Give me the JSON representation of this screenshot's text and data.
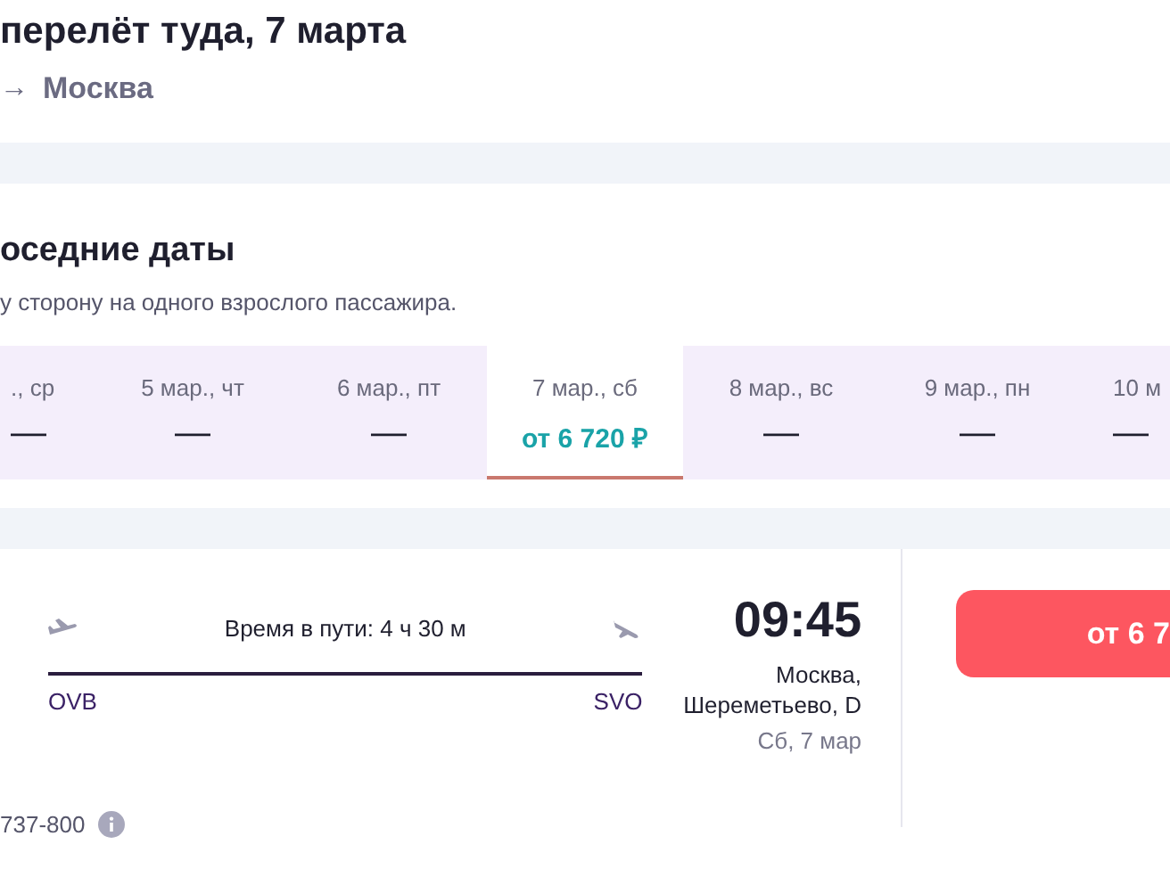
{
  "header": {
    "title": "перелёт туда, 7 марта",
    "route_arrow": "→",
    "route_city": "Москва"
  },
  "nearby_dates": {
    "title": "оседние даты",
    "subtitle": "у сторону на одного взрослого пассажира.",
    "dates": [
      {
        "date": "., ср",
        "price": "—",
        "selected": false
      },
      {
        "date": "5 мар., чт",
        "price": "—",
        "selected": false
      },
      {
        "date": "6 мар., пт",
        "price": "—",
        "selected": false
      },
      {
        "date": "7 мар., сб",
        "price": "от 6 720 ₽",
        "selected": true
      },
      {
        "date": "8 мар., вс",
        "price": "—",
        "selected": false
      },
      {
        "date": "9 мар., пн",
        "price": "—",
        "selected": false
      },
      {
        "date": "10 м",
        "price": "—",
        "selected": false
      }
    ]
  },
  "flight": {
    "duration": "Время в пути: 4 ч 30 м",
    "from_code": "OVB",
    "to_code": "SVO",
    "arrival_time": "09:45",
    "arrival_city": "Москва,",
    "arrival_airport": "Шереметьево, D",
    "arrival_date": "Сб, 7 мар",
    "aircraft": "737-800",
    "price_button": "от 6 7"
  }
}
